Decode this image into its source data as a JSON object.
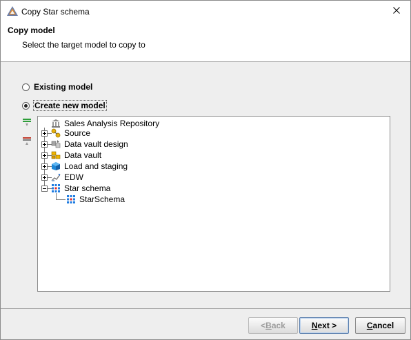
{
  "window": {
    "title": "Copy Star schema"
  },
  "header": {
    "title": "Copy model",
    "subtitle": "Select the target model to copy to"
  },
  "options": {
    "existing": {
      "label": "Existing model",
      "selected": false
    },
    "create_new": {
      "label": "Create new model",
      "selected": true
    }
  },
  "tree": {
    "root": {
      "label": "Sales Analysis Repository",
      "icon": "repository-icon"
    },
    "items": [
      {
        "label": "Source",
        "icon": "source-icon",
        "expanded": false
      },
      {
        "label": "Data vault design",
        "icon": "data-vault-design-icon",
        "expanded": false
      },
      {
        "label": "Data vault",
        "icon": "data-vault-icon",
        "expanded": false
      },
      {
        "label": "Load and staging",
        "icon": "load-staging-icon",
        "expanded": false
      },
      {
        "label": "EDW",
        "icon": "edw-icon",
        "expanded": false
      },
      {
        "label": "Star schema",
        "icon": "star-schema-icon",
        "expanded": true
      }
    ],
    "child": {
      "label": "StarSchema",
      "icon": "star-schema-model-icon"
    }
  },
  "buttons": {
    "back": {
      "pre": "< ",
      "mnemonic": "B",
      "post": "ack",
      "enabled": false
    },
    "next": {
      "pre": "",
      "mnemonic": "N",
      "post": "ext >",
      "enabled": true
    },
    "cancel": {
      "pre": "",
      "mnemonic": "C",
      "post": "ancel",
      "enabled": true
    }
  },
  "colors": {
    "panel_bg": "#eeeeee",
    "tree_bg": "#ffffff",
    "disabled_text": "#9c9c9c",
    "add_green": "#2e9e3a",
    "remove_red": "#c0392b"
  }
}
